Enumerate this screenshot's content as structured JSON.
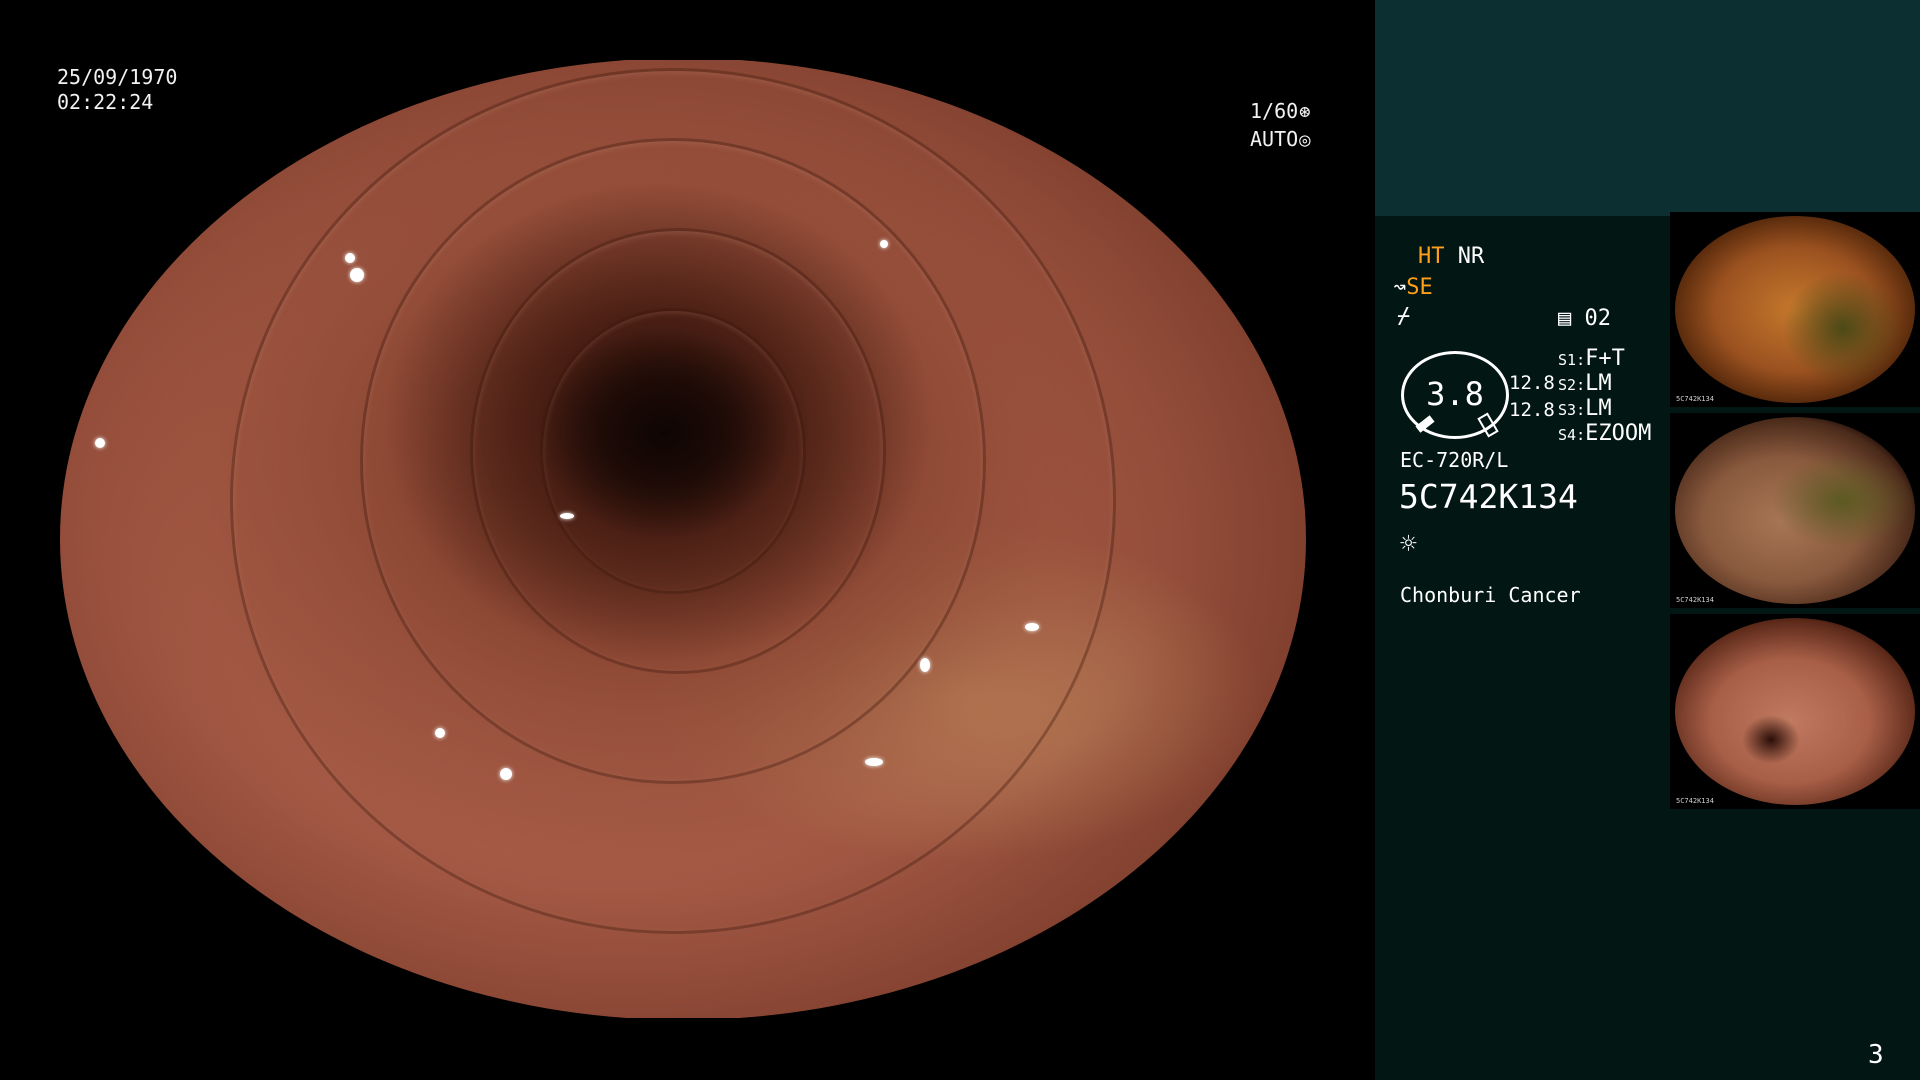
{
  "overlay": {
    "date": "25/09/1970",
    "time": "02:22:24",
    "shutter": "1/60",
    "shutter_icon": "shutter-icon",
    "iris": "AUTO",
    "iris_icon": "iris-icon"
  },
  "panel": {
    "ht_label": "HT",
    "nr_label": "NR",
    "se_label": "SE",
    "se_icon": "scope-tip-icon",
    "struct_icon": "structure-enhance-icon",
    "memory_icon": "memory-card-icon",
    "memory_value": "02",
    "dial_value": "3.8",
    "dial_side_1": "12.8",
    "dial_side_2": "12.8",
    "switches": [
      {
        "key": "S1",
        "value": "F+T"
      },
      {
        "key": "S2",
        "value": "LM"
      },
      {
        "key": "S3",
        "value": "LM"
      },
      {
        "key": "S4",
        "value": "EZOOM"
      }
    ],
    "scope_model": "EC-720R/L",
    "scope_serial": "5C742K134",
    "light_icon": "light-source-icon",
    "hospital": "Chonburi Cancer"
  },
  "thumbnails": [
    {
      "caption": "5C742K134"
    },
    {
      "caption": "5C742K134"
    },
    {
      "caption": "5C742K134"
    }
  ],
  "page_number": "3",
  "colors": {
    "panel_top": "#0c2f31",
    "panel_body": "#021613",
    "highlight": "#ff9f1a",
    "text": "#ffffff"
  }
}
